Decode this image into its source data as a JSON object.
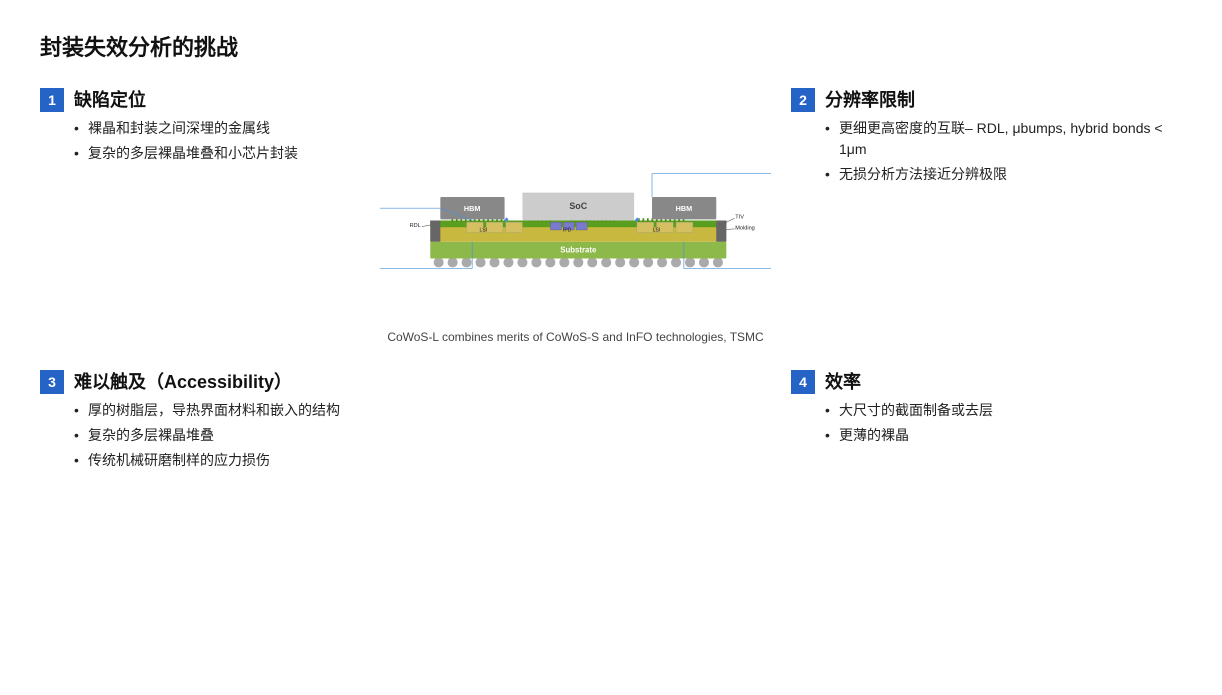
{
  "title": "封装失效分析的挑战",
  "section1": {
    "number": "1",
    "heading": "缺陷定位",
    "bullets": [
      "裸晶和封装之间深埋的金属线",
      "复杂的多层裸晶堆叠和小芯片封装"
    ]
  },
  "section2": {
    "number": "2",
    "heading": "分辨率限制",
    "bullets": [
      "更细更高密度的互联– RDL, μbumps, hybrid bonds < 1μm",
      "无损分析方法接近分辨极限"
    ]
  },
  "section3": {
    "number": "3",
    "heading": "难以触及（Accessibility）",
    "bullets": [
      "厚的树脂层，导热界面材料和嵌入的结构",
      "复杂的多层裸晶堆叠",
      "传统机械研磨制样的应力损伤"
    ]
  },
  "section4": {
    "number": "4",
    "heading": "效率",
    "bullets": [
      "大尺寸的截面制备或去层",
      "更薄的裸晶"
    ]
  },
  "diagram": {
    "caption": "CoWoS-L combines merits of CoWoS-S and InFO technologies, TSMC",
    "labels": {
      "hbm_left": "HBM",
      "soc": "SoC",
      "hbm_right": "HBM",
      "substrate": "Substrate",
      "rdl": "RDL",
      "lsi_left": "LSI",
      "ipd": "IPD",
      "lsi_right": "LSI",
      "tiv": "TIV",
      "molding": "Molding"
    }
  }
}
